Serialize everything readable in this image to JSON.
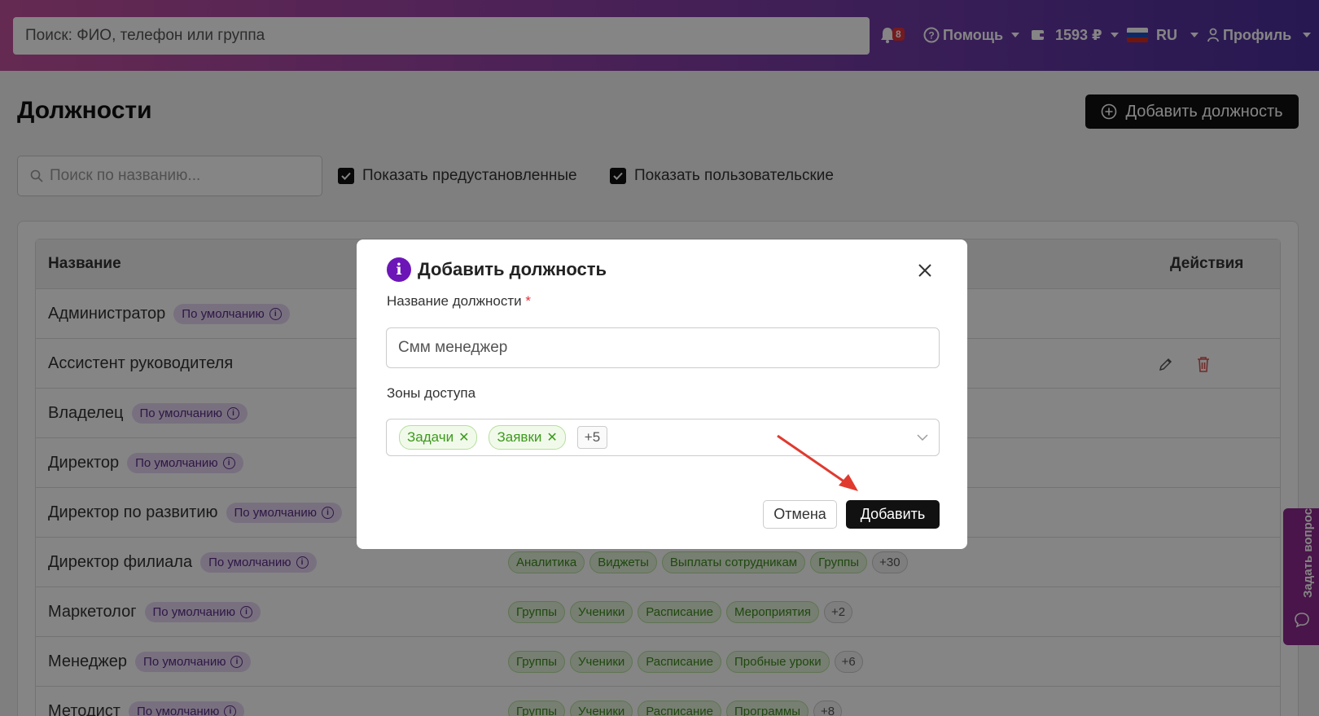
{
  "topbar": {
    "search_placeholder": "Поиск: ФИО, телефон или группа",
    "notifications_count": "8",
    "help_label": "Помощь",
    "balance_label": "1593 ₽",
    "language_label": "RU",
    "profile_label": "Профиль"
  },
  "page": {
    "title": "Должности",
    "add_button": "Добавить должность",
    "search_placeholder": "Поиск по названию...",
    "show_predefined": "Показать предустановленные",
    "show_custom": "Показать пользовательские"
  },
  "table": {
    "col_name": "Название",
    "col_actions": "Действия",
    "default_badge": "По умолчанию",
    "rows": [
      {
        "name": "Администратор",
        "default": true,
        "zones": [],
        "more": ""
      },
      {
        "name": "Ассистент руководителя",
        "default": false,
        "zones": [],
        "more": ""
      },
      {
        "name": "Владелец",
        "default": true,
        "zones": [],
        "more": ""
      },
      {
        "name": "Директор",
        "default": true,
        "zones": [],
        "more": ""
      },
      {
        "name": "Директор по развитию",
        "default": true,
        "zones": [],
        "more": ""
      },
      {
        "name": "Директор филиала",
        "default": true,
        "zones": [
          "Аналитика",
          "Виджеты",
          "Выплаты сотрудникам",
          "Группы"
        ],
        "more": "+30"
      },
      {
        "name": "Маркетолог",
        "default": true,
        "zones": [
          "Группы",
          "Ученики",
          "Расписание",
          "Мероприятия"
        ],
        "more": "+2"
      },
      {
        "name": "Менеджер",
        "default": true,
        "zones": [
          "Группы",
          "Ученики",
          "Расписание",
          "Пробные уроки"
        ],
        "more": "+6"
      },
      {
        "name": "Методист",
        "default": true,
        "zones": [
          "Группы",
          "Ученики",
          "Расписание",
          "Программы"
        ],
        "more": "+8"
      }
    ]
  },
  "side_tab": {
    "label": "Задать вопрос"
  },
  "modal": {
    "title": "Добавить должность",
    "name_label": "Название должности",
    "required_mark": "*",
    "name_value": "Смм менеджер",
    "zones_label": "Зоны доступа",
    "selected_zones": [
      "Задачи",
      "Заявки"
    ],
    "more_zones": "+5",
    "cancel_label": "Отмена",
    "submit_label": "Добавить"
  },
  "colors": {
    "modal_info_icon": "#6c16b8",
    "primary_button": "#111111",
    "annotation_arrow": "#e03a2f"
  }
}
